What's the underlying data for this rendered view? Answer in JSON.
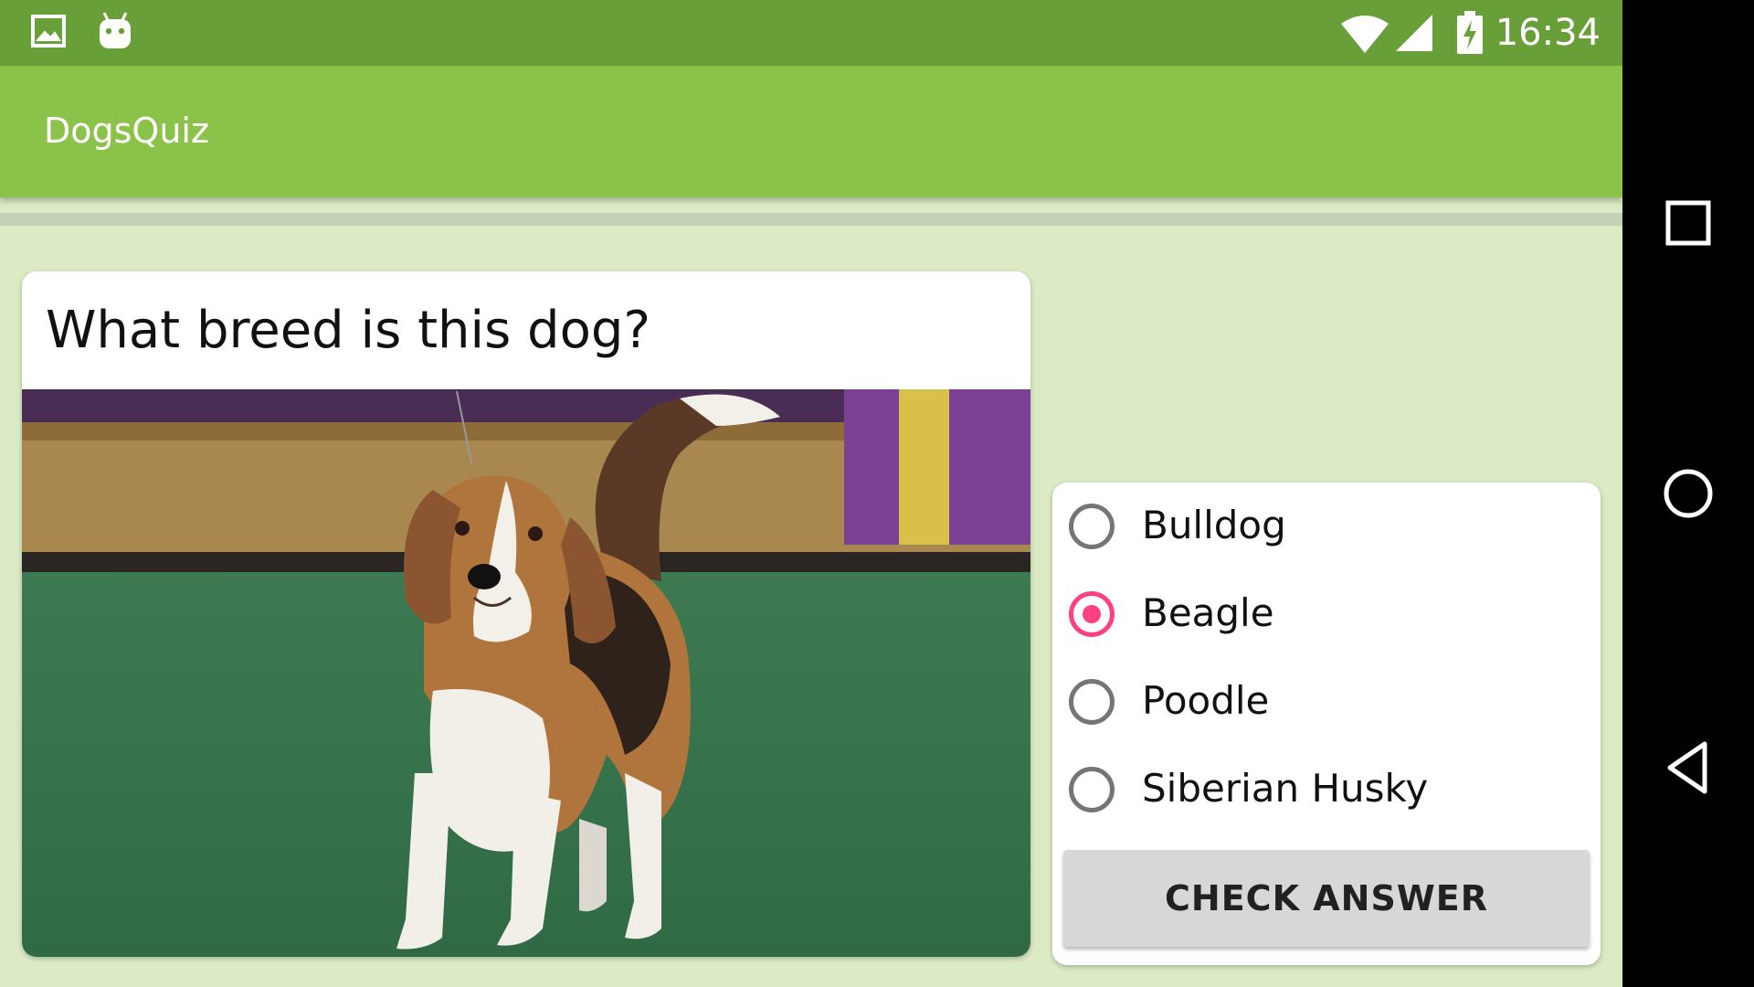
{
  "status_bar": {
    "time": "16:34",
    "left_icons": [
      "image-icon",
      "android-icon"
    ],
    "right_icons": [
      "wifi-icon",
      "signal-icon",
      "battery-charging-icon"
    ]
  },
  "app_bar": {
    "title": "DogsQuiz"
  },
  "question": {
    "text": "What breed is this dog?",
    "image_subject": "beagle-dog-photo"
  },
  "answers": {
    "options": [
      {
        "label": "Bulldog",
        "selected": false
      },
      {
        "label": "Beagle",
        "selected": true
      },
      {
        "label": "Poodle",
        "selected": false
      },
      {
        "label": "Siberian Husky",
        "selected": false
      }
    ],
    "check_button_label": "CHECK ANSWER"
  },
  "nav_bar": {
    "buttons": [
      "recents-icon",
      "home-icon",
      "back-icon"
    ]
  },
  "colors": {
    "status_bar": "#689f38",
    "app_bar": "#8bc34a",
    "background": "#dcebc6",
    "accent": "#ff4081"
  }
}
